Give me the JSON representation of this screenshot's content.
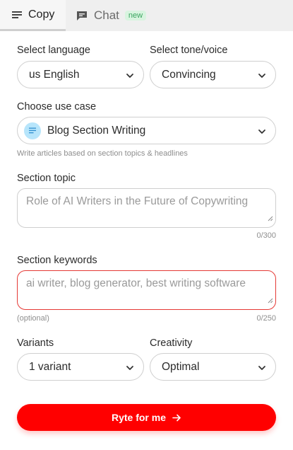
{
  "tabs": {
    "copy": {
      "label": "Copy",
      "icon": "lines-icon"
    },
    "chat": {
      "label": "Chat",
      "badge": "new",
      "icon": "chat-bubble-icon"
    }
  },
  "language": {
    "label": "Select language",
    "value": "us English"
  },
  "tone": {
    "label": "Select tone/voice",
    "value": "Convincing"
  },
  "use_case": {
    "label": "Choose use case",
    "value": "Blog Section Writing",
    "icon": "document-lines-icon",
    "hint": "Write articles based on section topics & headlines"
  },
  "section_topic": {
    "label": "Section topic",
    "value": "",
    "placeholder": "Role of AI Writers in the Future of Copywriting",
    "counter": "0/300"
  },
  "section_keywords": {
    "label": "Section keywords",
    "value": "",
    "placeholder": "ai writer, blog generator, best writing software",
    "optional": "(optional)",
    "counter": "0/250"
  },
  "variants": {
    "label": "Variants",
    "value": "1 variant"
  },
  "creativity": {
    "label": "Creativity",
    "value": "Optimal"
  },
  "submit": {
    "label": "Ryte for me"
  },
  "colors": {
    "accent": "#ff0000",
    "focus_border": "#e53935",
    "badge_text": "#3aa55f",
    "usecase_icon_bg": "#b7e5fb"
  }
}
